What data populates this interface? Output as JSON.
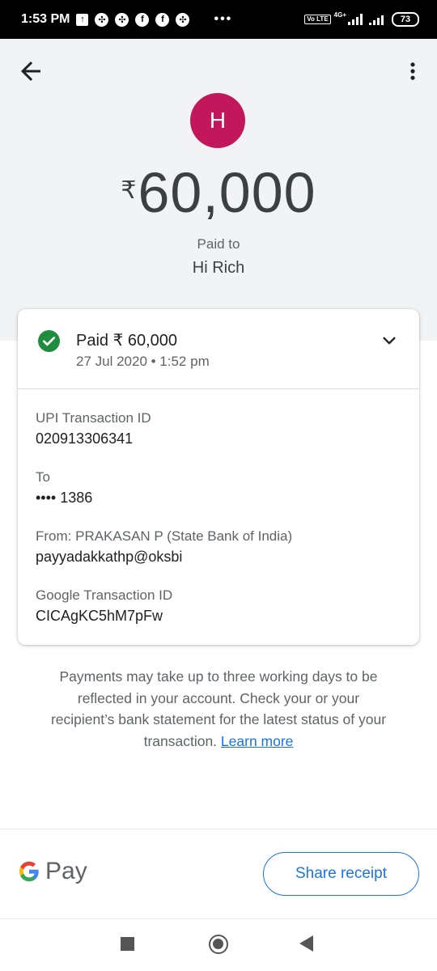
{
  "status_bar": {
    "time": "1:53 PM",
    "network": "4G+",
    "volte": "Vo LTE",
    "battery": "73"
  },
  "header": {
    "avatar_initial": "H",
    "currency_symbol": "₹",
    "amount": "60,000",
    "paid_to_label": "Paid to",
    "payee_name": "Hi Rich"
  },
  "card": {
    "status": "Paid ₹ 60,000",
    "datetime": "27 Jul 2020 • 1:52 pm",
    "details": [
      {
        "label": "UPI Transaction ID",
        "value": "020913306341"
      },
      {
        "label": "To",
        "value": "•••• 1386"
      },
      {
        "label": "From: PRAKASAN  P (State Bank of India)",
        "value": "payyadakkathp@oksbi"
      },
      {
        "label": "Google Transaction ID",
        "value": "CICAgKC5hM7pFw"
      }
    ]
  },
  "info": {
    "text": "Payments may take up to three working days to be reflected in your account. Check your or your recipient’s bank statement for the latest status of your transaction.",
    "link": "Learn more"
  },
  "footer": {
    "logo_text": "Pay",
    "share_label": "Share receipt"
  },
  "colors": {
    "accent": "#1a73e8",
    "avatar": "#c2185b",
    "success": "#1e8e3e",
    "header_bg": "#f1f3f4"
  }
}
